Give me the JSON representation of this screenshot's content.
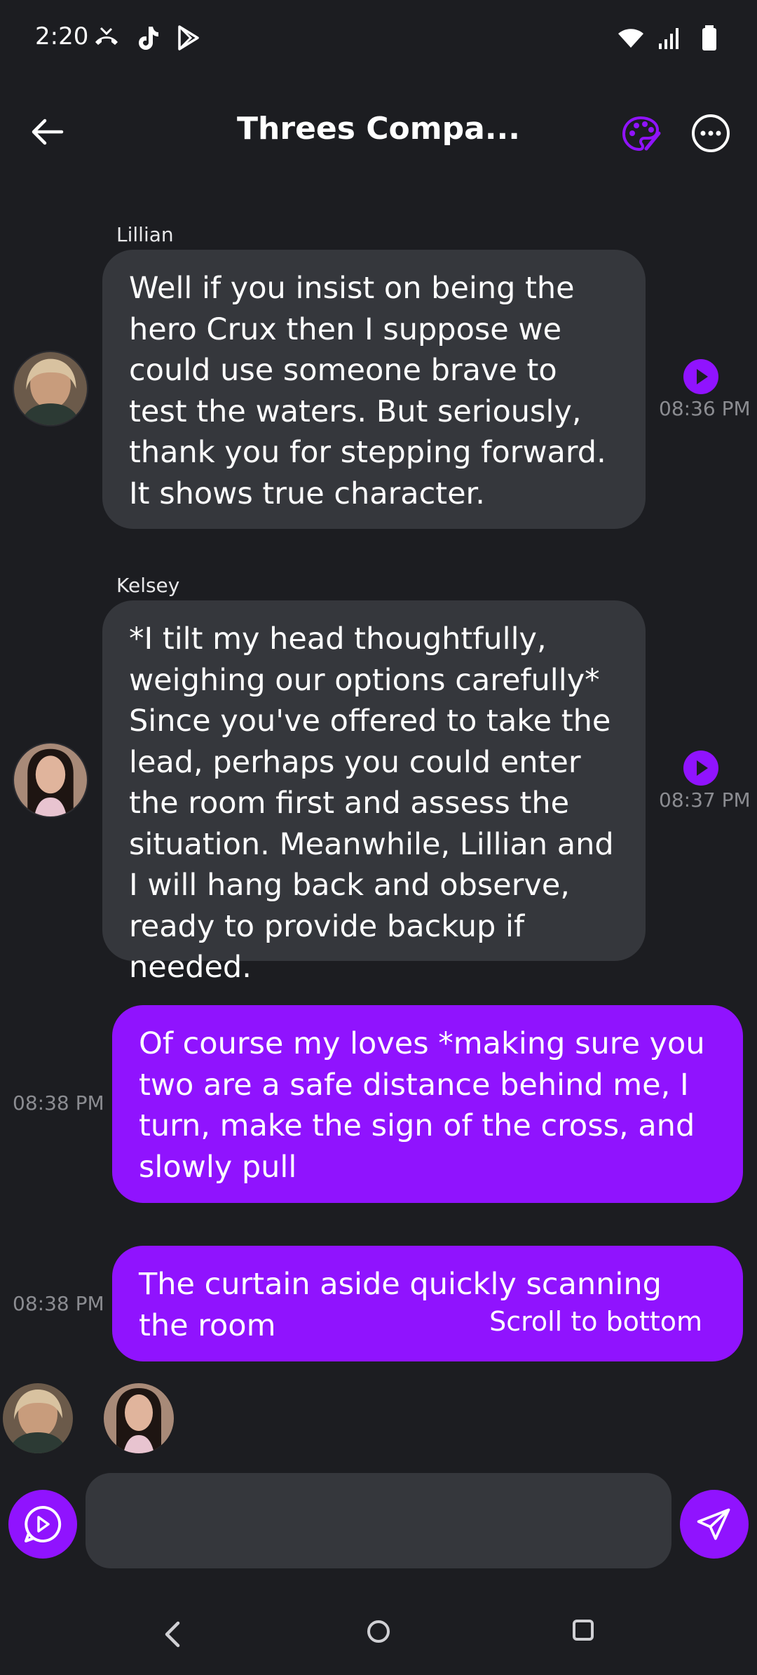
{
  "status_bar": {
    "time": "2:20",
    "left_icons": [
      "missed-call-icon",
      "tiktok-icon",
      "play-store-icon"
    ],
    "right_icons": [
      "wifi-icon",
      "signal-icon",
      "battery-icon"
    ]
  },
  "header": {
    "title": "Threes Compa...",
    "back_icon": "arrow-left-icon",
    "palette_icon": "palette-icon",
    "more_icon": "more-horizontal-icon"
  },
  "messages": [
    {
      "sender": "Lillian",
      "direction": "incoming",
      "text": "Well if you insist on being the hero Crux then I suppose we could use someone brave to test the waters. But seriously, thank you for stepping forward. It shows true character.",
      "time": "08:36 PM"
    },
    {
      "sender": "Kelsey",
      "direction": "incoming",
      "text": "*I tilt my head thoughtfully, weighing our options carefully* Since you've offered to take the lead, perhaps you could enter the room first and assess the situation. Meanwhile, Lillian and I will hang back and observe, ready to provide backup if needed.",
      "time": "08:37 PM"
    },
    {
      "direction": "outgoing",
      "text": "Of course my loves *making sure you two are a safe distance behind me, I turn, make the sign of the cross, and slowly pull",
      "time": "08:38 PM"
    },
    {
      "direction": "outgoing",
      "text": "The curtain aside quickly scanning the room",
      "time": "08:38 PM"
    }
  ],
  "scroll_hint": "Scroll to bottom",
  "composer": {
    "value": "",
    "placeholder": ""
  },
  "colors": {
    "background": "#1c1d21",
    "incoming_bubble": "#35373c",
    "outgoing_bubble": "#9013fe",
    "accent": "#9013fe"
  }
}
